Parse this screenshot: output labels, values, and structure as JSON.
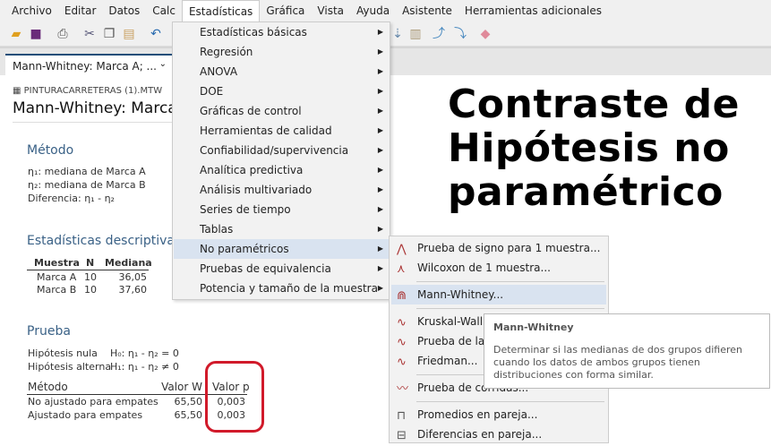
{
  "menubar": [
    "Archivo",
    "Editar",
    "Datos",
    "Calc",
    "Estadísticas",
    "Gráfica",
    "Vista",
    "Ayuda",
    "Asistente",
    "Herramientas adicionales"
  ],
  "tab": {
    "label": "Mann-Whitney: Marca A; ..."
  },
  "worksheet": "PINTURACARRETERAS (1).MTW",
  "title": "Mann-Whitney: Marca",
  "metodo": {
    "heading": "Método",
    "lines": [
      "η₁: mediana de Marca A",
      "η₂: mediana de Marca B",
      "Diferencia: η₁ - η₂"
    ]
  },
  "descriptivas": {
    "heading": "Estadísticas descriptivas",
    "headers": [
      "Muestra",
      "N",
      "Mediana"
    ],
    "rows": [
      [
        "Marca A",
        "10",
        "36,05"
      ],
      [
        "Marca B",
        "10",
        "37,60"
      ]
    ]
  },
  "prueba": {
    "heading": "Prueba",
    "nula_label": "Hipótesis nula",
    "nula": "H₀: η₁ - η₂ = 0",
    "alterna_label": "Hipótesis alterna",
    "alterna": "H₁: η₁ - η₂ ≠ 0",
    "headers": [
      "Método",
      "Valor W",
      "Valor p"
    ],
    "rows": [
      [
        "No ajustado para empates",
        "65,50",
        "0,003"
      ],
      [
        "Ajustado para empates",
        "65,50",
        "0,003"
      ]
    ]
  },
  "overlay": {
    "lines": [
      "Contraste de",
      "Hipótesis no",
      "paramétrico"
    ]
  },
  "menu": [
    "Estadísticas básicas",
    "Regresión",
    "ANOVA",
    "DOE",
    "Gráficas de control",
    "Herramientas de calidad",
    "Confiabilidad/supervivencia",
    "Analítica predictiva",
    "Análisis multivariado",
    "Series de tiempo",
    "Tablas",
    "No paramétricos",
    "Pruebas de equivalencia",
    "Potencia y tamaño de la muestra"
  ],
  "submenu": [
    "Prueba de signo para 1 muestra...",
    "Wilcoxon de 1 muestra...",
    "Mann-Whitney...",
    "Kruskal-Wallis...",
    "Prueba de la mediana de Mood...",
    "Friedman...",
    "Prueba de corridas...",
    "Promedios en pareja...",
    "Diferencias en pareja..."
  ],
  "tooltip": {
    "title": "Mann-Whitney",
    "desc": "Determinar si las medianas de dos grupos difieren cuando los datos de ambos grupos tienen distribuciones con forma similar."
  }
}
